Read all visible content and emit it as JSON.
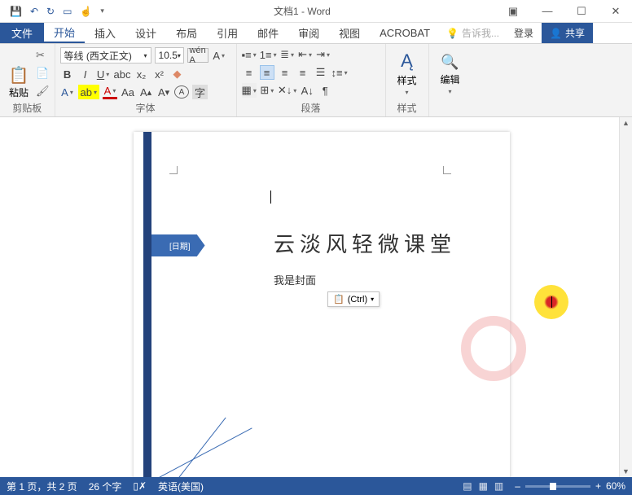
{
  "titlebar": {
    "title": "文档1 - Word"
  },
  "tabs": {
    "file": "文件",
    "items": [
      "开始",
      "插入",
      "设计",
      "布局",
      "引用",
      "邮件",
      "审阅",
      "视图",
      "ACROBAT"
    ],
    "active": 0,
    "tellme": "告诉我...",
    "signin": "登录",
    "share": "共享"
  },
  "ribbon": {
    "clipboard": {
      "paste": "粘贴",
      "label": "剪贴板"
    },
    "font": {
      "name": "等线 (西文正文)",
      "size": "10.5",
      "label": "字体"
    },
    "paragraph": {
      "label": "段落"
    },
    "styles": {
      "label": "样式",
      "btn": "样式"
    },
    "editing": {
      "label": "编辑",
      "btn": "编辑"
    }
  },
  "document": {
    "date_label": "[日期]",
    "heading": "云淡风轻微课堂",
    "subtext": "我是封面",
    "paste_opt": "(Ctrl)"
  },
  "status": {
    "page": "第 1 页，共 2 页",
    "words": "26 个字",
    "lang": "英语(美国)",
    "zoom": "60%"
  }
}
